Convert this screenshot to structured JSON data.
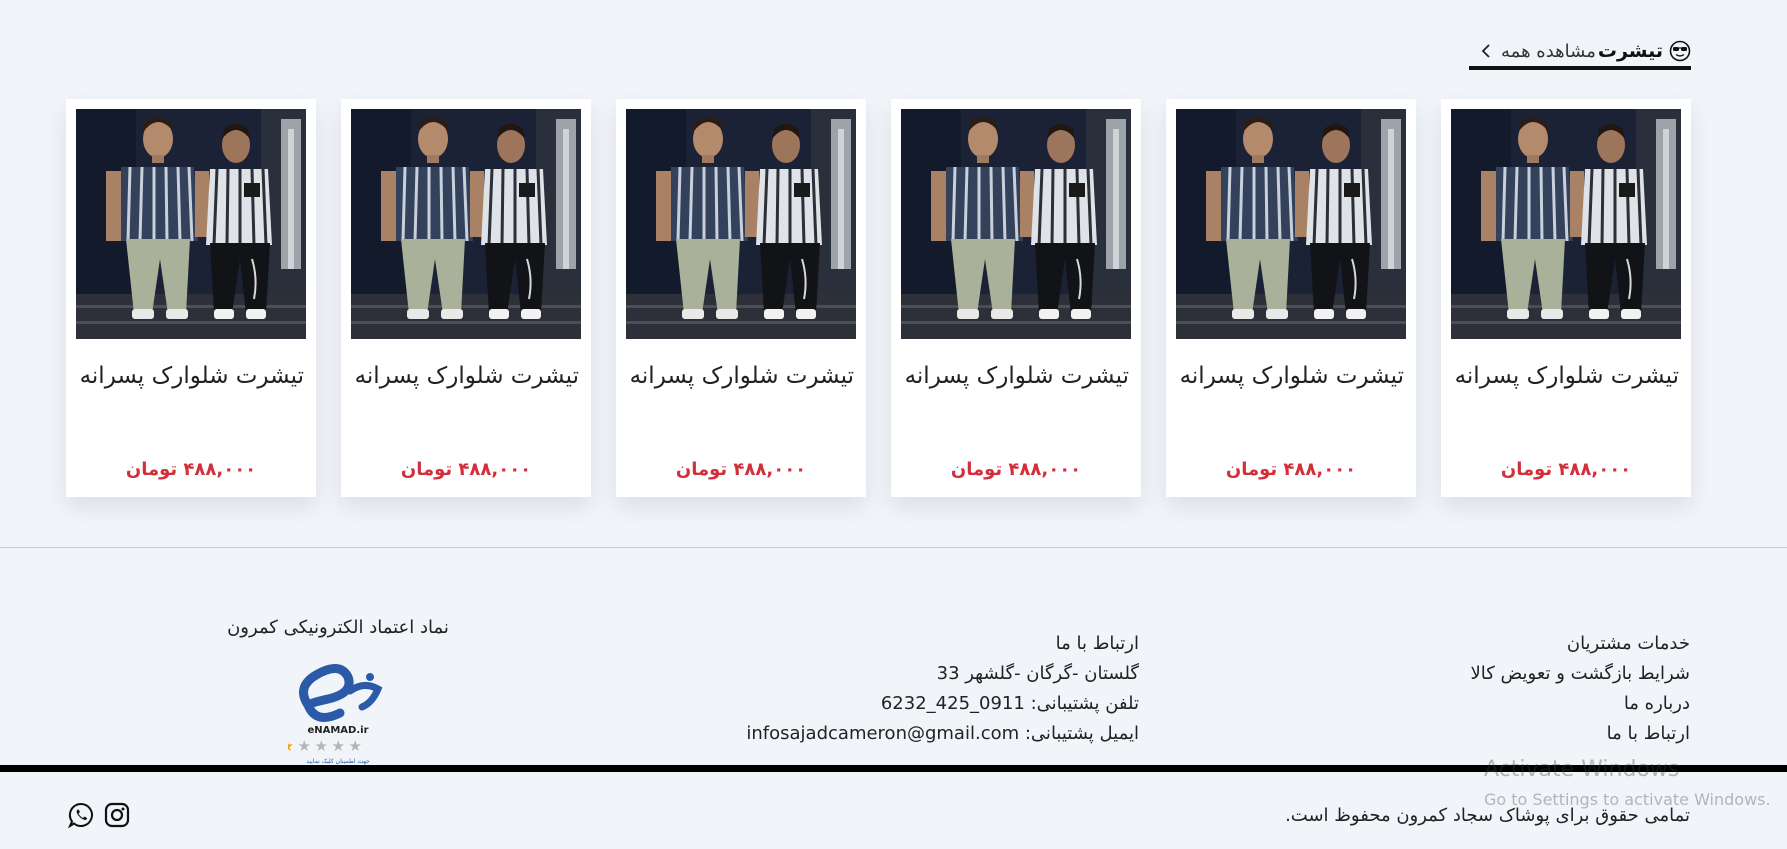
{
  "section": {
    "title": "تیشرت",
    "view_all": "مشاهده همه",
    "emoji_icon": "sunglasses-emoji-icon"
  },
  "products": [
    {
      "name": "تیشرت شلوارک پسرانه",
      "price": "۴۸۸,۰۰۰ تومان"
    },
    {
      "name": "تیشرت شلوارک پسرانه",
      "price": "۴۸۸,۰۰۰ تومان"
    },
    {
      "name": "تیشرت شلوارک پسرانه",
      "price": "۴۸۸,۰۰۰ تومان"
    },
    {
      "name": "تیشرت شلوارک پسرانه",
      "price": "۴۸۸,۰۰۰ تومان"
    },
    {
      "name": "تیشرت شلوارک پسرانه",
      "price": "۴۸۸,۰۰۰ تومان"
    },
    {
      "name": "تیشرت شلوارک پسرانه",
      "price": "۴۸۸,۰۰۰ تومان"
    }
  ],
  "footer": {
    "services": {
      "title": "خدمات مشتریان",
      "links": [
        "شرایط بازگشت و تعویض کالا",
        "درباره ما",
        "ارتباط با ما"
      ]
    },
    "contact": {
      "title": "ارتباط با ما",
      "address": "گلستان -گرگان -گلشهر 33",
      "phone": "تلفن پشتیبانی: 0911_425_6232",
      "email": "ایمیل پشتیبانی: infosajadcameron@gmail.com"
    },
    "trust": {
      "title": "نماد اعتماد الکترونیکی کمرون",
      "logo_text": "eNAMAD.ir",
      "stars": 1,
      "stars_total": 5,
      "caption": "جهت اطمینان کلیک نمایید"
    },
    "copyright": "تمامی حقوق برای پوشاک سجاد کمرون محفوظ است.",
    "social": [
      "whatsapp-icon",
      "instagram-icon"
    ]
  },
  "watermark": {
    "title": "Activate Windows",
    "subtitle": "Go to Settings to activate Windows."
  },
  "colors": {
    "background": "#f1f4f9",
    "price": "#d32f3a",
    "text": "#222222",
    "bar": "#000000"
  }
}
